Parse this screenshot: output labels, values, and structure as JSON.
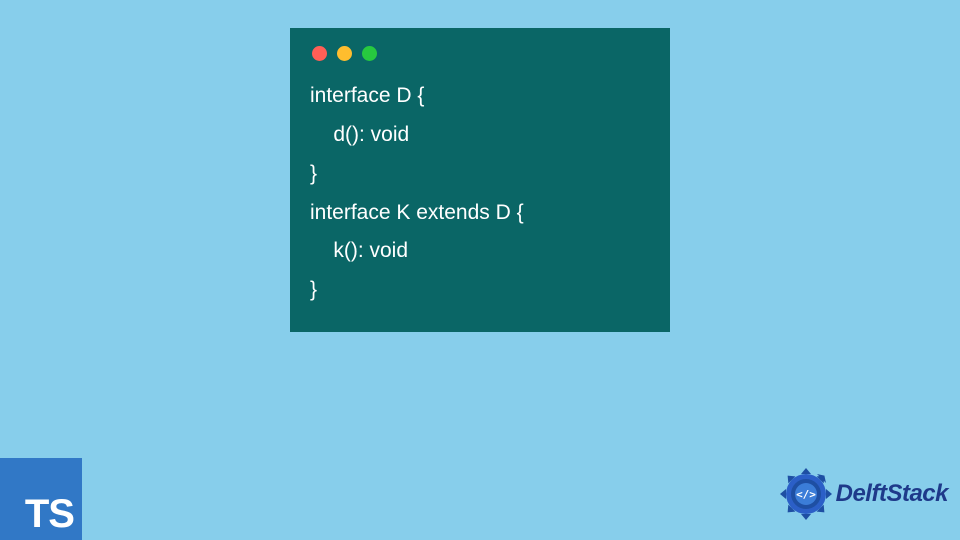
{
  "code": {
    "lines": [
      "interface D {",
      "    d(): void",
      "}",
      "interface K extends D {",
      "    k(): void",
      "}"
    ]
  },
  "logos": {
    "typescript": "TS",
    "delftstack": "DelftStack"
  },
  "colors": {
    "background": "#87ceeb",
    "codeWindow": "#0a6666",
    "tsLogo": "#3178c6",
    "delftBlue": "#1e3a8a"
  }
}
